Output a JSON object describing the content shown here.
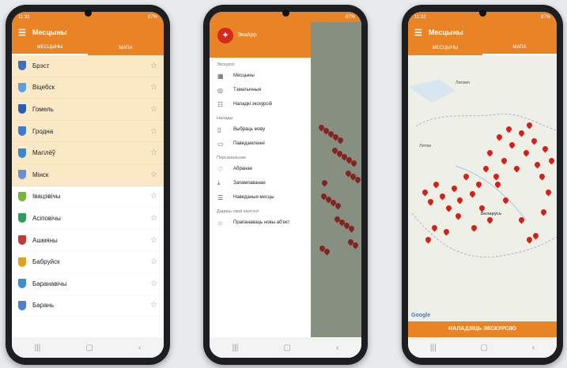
{
  "status": {
    "time": "11:32",
    "battery": "87%"
  },
  "app": {
    "title": "Месцыны",
    "name": "ЭкаАрр"
  },
  "tabs": {
    "places": "МЕСЦЫНЫ",
    "map": "МАПА"
  },
  "places": [
    {
      "name": "Брэст",
      "crest_color": "#3f6fc6",
      "highlight": true
    },
    {
      "name": "Віцебск",
      "crest_color": "#5aa0e0",
      "highlight": true
    },
    {
      "name": "Гомель",
      "crest_color": "#2a5db8",
      "highlight": true
    },
    {
      "name": "Гродна",
      "crest_color": "#3c7bd0",
      "highlight": true
    },
    {
      "name": "Магілёў",
      "crest_color": "#3e86c8",
      "highlight": true
    },
    {
      "name": "Мінск",
      "crest_color": "#6a8fd6",
      "highlight": true
    },
    {
      "name": "Івацэвічы",
      "crest_color": "#6fb83a",
      "highlight": false
    },
    {
      "name": "Асіповічы",
      "crest_color": "#2f9a5a",
      "highlight": false
    },
    {
      "name": "Ашмяны",
      "crest_color": "#c23a3a",
      "highlight": false
    },
    {
      "name": "Бабруйск",
      "crest_color": "#e0a020",
      "highlight": false
    },
    {
      "name": "Баранавічы",
      "crest_color": "#3b8fd0",
      "highlight": false
    },
    {
      "name": "Барань",
      "crest_color": "#4a7fd3",
      "highlight": false
    }
  ],
  "drawer": {
    "sections": [
      {
        "title": "Экскурсіі",
        "items": [
          {
            "label": "Месцыны",
            "icon": "grid-icon"
          },
          {
            "label": "Тэматычныя",
            "icon": "target-icon"
          },
          {
            "label": "Наладкі экскурсій",
            "icon": "sliders-icon"
          }
        ]
      },
      {
        "title": "Налады",
        "items": [
          {
            "label": "Выбраць мову",
            "icon": "doc-icon"
          },
          {
            "label": "Паведамленні",
            "icon": "phone-icon"
          }
        ]
      },
      {
        "title": "Персанальнае",
        "items": [
          {
            "label": "Абранае",
            "icon": "heart-icon"
          },
          {
            "label": "Запампаванае",
            "icon": "download-icon"
          },
          {
            "label": "Наведаныя месцы",
            "icon": "list-icon"
          }
        ]
      },
      {
        "title": "Дадаць свой кантэнт",
        "items": [
          {
            "label": "Прапанаваць новы аб'ект",
            "icon": "star-icon"
          }
        ]
      }
    ]
  },
  "map": {
    "button": "НАЛАДЗІЦЬ ЭКСКУРСІЮ",
    "google": "Google",
    "labels": [
      "Латвия",
      "Литва",
      "Беларусь"
    ]
  },
  "nav": {
    "recent": "|||",
    "home": "▢",
    "back": "‹"
  }
}
